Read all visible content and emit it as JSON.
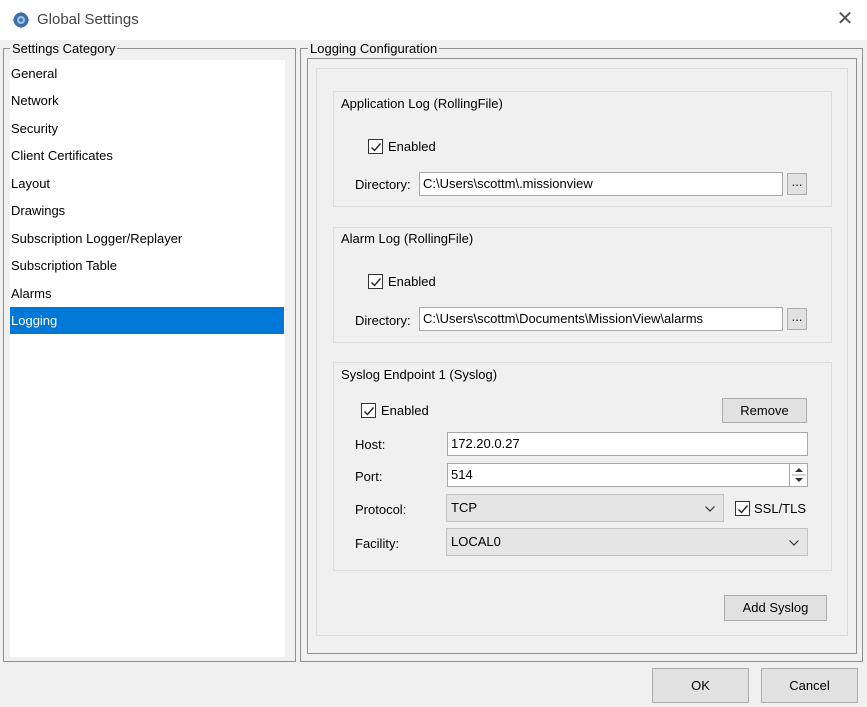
{
  "window": {
    "title": "Global Settings",
    "close_glyph": "✕"
  },
  "category_panel": {
    "legend": "Settings Category",
    "items": [
      "General",
      "Network",
      "Security",
      "Client Certificates",
      "Layout",
      "Drawings",
      "Subscription Logger/Replayer",
      "Subscription Table",
      "Alarms",
      "Logging"
    ],
    "selected": "Logging"
  },
  "logging": {
    "legend": "Logging Configuration",
    "app_log": {
      "title": "Application Log (RollingFile)",
      "enabled_label": "Enabled",
      "enabled": true,
      "directory_label": "Directory:",
      "directory_value": "C:\\Users\\scottm\\.missionview",
      "browse_label": "..."
    },
    "alarm_log": {
      "title": "Alarm Log (RollingFile)",
      "enabled_label": "Enabled",
      "enabled": true,
      "directory_label": "Directory:",
      "directory_value": "C:\\Users\\scottm\\Documents\\MissionView\\alarms",
      "browse_label": "..."
    },
    "syslog": {
      "title": "Syslog Endpoint 1 (Syslog)",
      "enabled_label": "Enabled",
      "enabled": true,
      "remove_label": "Remove",
      "host_label": "Host:",
      "host_value": "172.20.0.27",
      "port_label": "Port:",
      "port_value": "514",
      "protocol_label": "Protocol:",
      "protocol_value": "TCP",
      "ssl_label": "SSL/TLS",
      "ssl_enabled": true,
      "facility_label": "Facility:",
      "facility_value": "LOCAL0"
    },
    "add_syslog_label": "Add Syslog"
  },
  "footer": {
    "ok_label": "OK",
    "cancel_label": "Cancel"
  },
  "colors": {
    "selection": "#0078d7",
    "window_bg": "#f0f0f0"
  },
  "icons": {
    "app": "globe-gear-icon",
    "check": "check-icon",
    "chevron": "chevron-down-icon",
    "spinner": "spinner-arrows-icon"
  }
}
